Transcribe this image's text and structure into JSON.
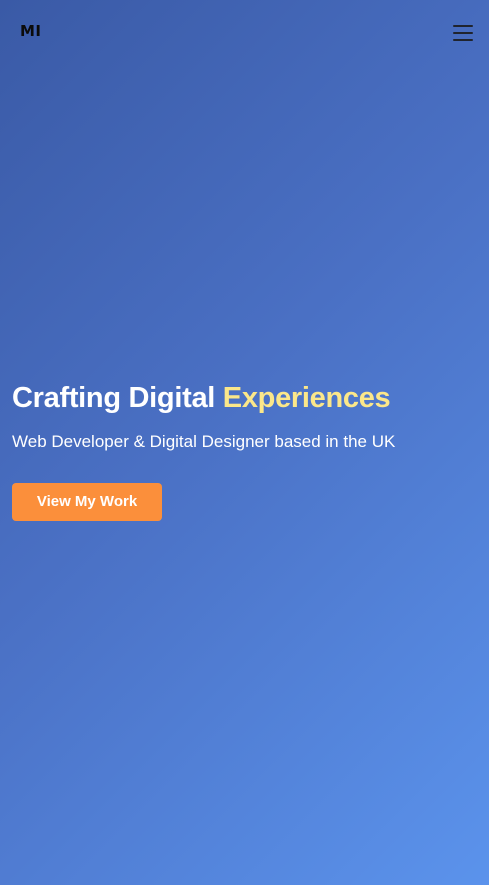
{
  "header": {
    "logo_text": "MI",
    "menu_icon": "hamburger-menu-icon"
  },
  "hero": {
    "title_main": "Crafting Digital ",
    "title_accent": "Experiences",
    "subtitle": "Web Developer & Digital Designer based in the UK",
    "cta_label": "View My Work"
  },
  "colors": {
    "background_start": "#3a5aa6",
    "background_end": "#5b93ec",
    "accent_text": "#fbe78a",
    "cta_background": "#fb8f3b",
    "logo": "#0b0b0b"
  }
}
